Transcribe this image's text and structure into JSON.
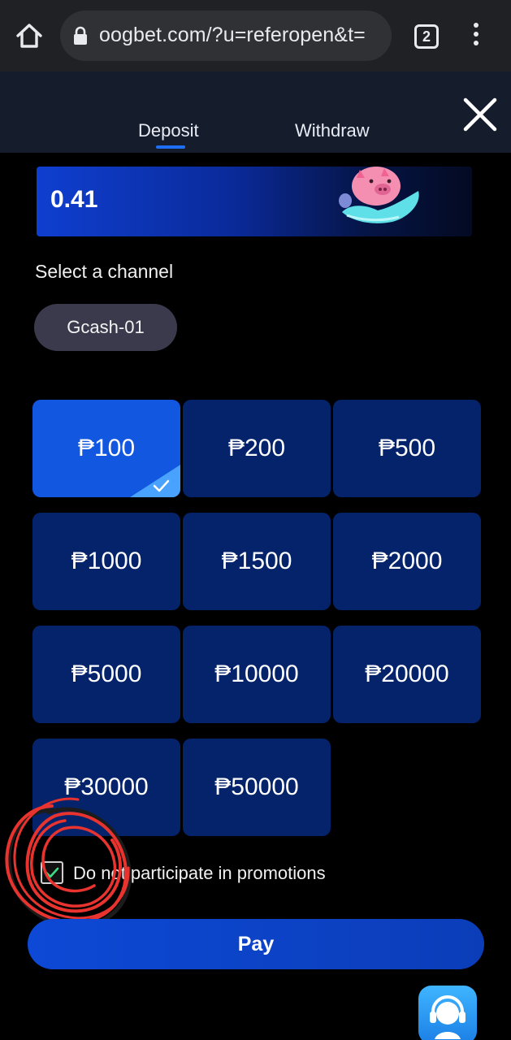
{
  "browser": {
    "url": "oogbet.com/?u=referopen&t=",
    "tab_count": "2"
  },
  "header": {
    "tabs": [
      {
        "label": "Deposit",
        "active": true
      },
      {
        "label": "Withdraw",
        "active": false
      }
    ]
  },
  "balance": {
    "value": "0.41"
  },
  "channel": {
    "section_label": "Select a channel",
    "selected": "Gcash-01"
  },
  "amounts": [
    {
      "label": "₱100",
      "selected": true
    },
    {
      "label": "₱200",
      "selected": false
    },
    {
      "label": "₱500",
      "selected": false
    },
    {
      "label": "₱1000",
      "selected": false
    },
    {
      "label": "₱1500",
      "selected": false
    },
    {
      "label": "₱2000",
      "selected": false
    },
    {
      "label": "₱5000",
      "selected": false
    },
    {
      "label": "₱10000",
      "selected": false
    },
    {
      "label": "₱20000",
      "selected": false
    },
    {
      "label": "₱30000",
      "selected": false
    },
    {
      "label": "₱50000",
      "selected": false
    }
  ],
  "promotions": {
    "label": "Do not participate in promotions",
    "checked": true
  },
  "pay_label": "Pay",
  "colors": {
    "accent": "#1f6ff5",
    "tile": "#05236b",
    "tile_selected": "#1157e0",
    "scribble": "#e8332e"
  },
  "icons": [
    "home-icon",
    "lock-icon",
    "tabs-icon",
    "more-vert-icon",
    "close-icon",
    "piggy-bank-icon",
    "check-icon",
    "headset-support-icon"
  ]
}
